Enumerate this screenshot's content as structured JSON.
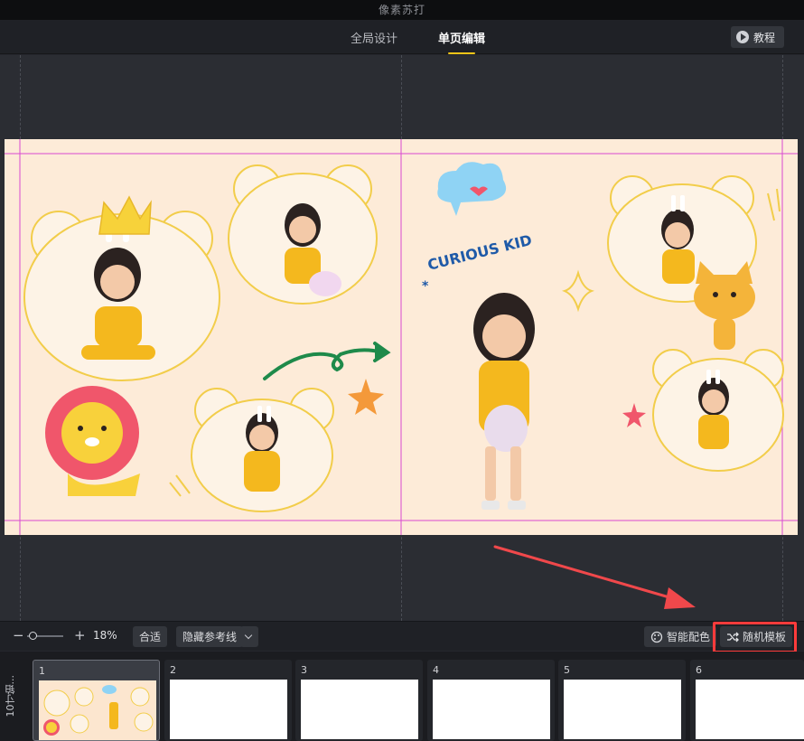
{
  "window": {
    "title": "像素苏打"
  },
  "nav": {
    "tabs": [
      {
        "label": "全局设计",
        "active": false
      },
      {
        "label": "单页编辑",
        "active": true
      }
    ],
    "tutorial_label": "教程"
  },
  "canvas": {
    "background_color": "#fdebd8",
    "guide_color": "#d94ad1",
    "decoration_text": "CURIOUS KID"
  },
  "toolbar": {
    "zoom_minus": "−",
    "zoom_plus": "+",
    "zoom_value": "18%",
    "fit_label": "合适",
    "guides_label": "隐藏参考线",
    "smart_color_label": "智能配色",
    "random_template_label": "随机模板"
  },
  "pages": {
    "label": "10寸铂...",
    "items": [
      {
        "number": "1",
        "active": true
      },
      {
        "number": "2",
        "active": false
      },
      {
        "number": "3",
        "active": false
      },
      {
        "number": "4",
        "active": false
      },
      {
        "number": "5",
        "active": false
      },
      {
        "number": "6",
        "active": false
      }
    ]
  },
  "colors": {
    "accent": "#f5c518",
    "highlight": "#ff3b3b",
    "arrow": "#f0484b"
  }
}
